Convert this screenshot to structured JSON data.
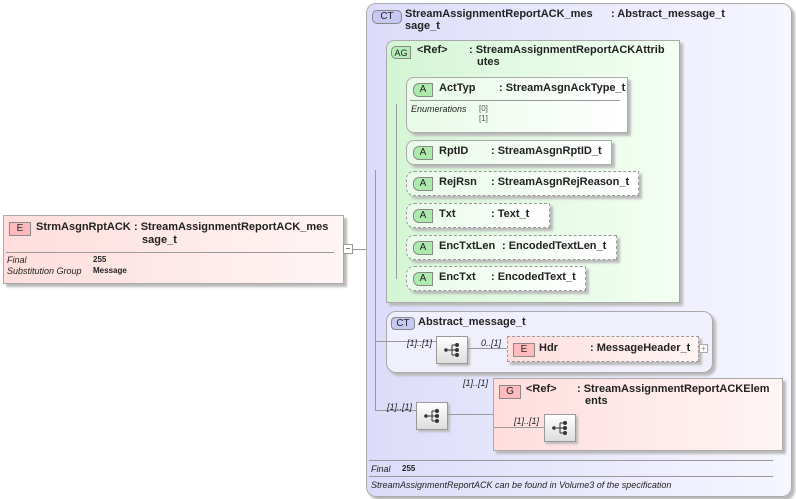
{
  "root": {
    "badge": "E",
    "name": "StrmAsgnRptACK",
    "type_line1": ": StreamAssignmentReportACK_mes",
    "type_line2": "sage_t",
    "props": [
      {
        "label": "Final",
        "value": "255"
      },
      {
        "label": "Substitution Group",
        "value": "Message"
      }
    ]
  },
  "complex_type": {
    "badge": "CT",
    "name": "StreamAssignmentReportACK_mes",
    "type_line1": ": Abstract_message_t",
    "type_line2": "sage_t",
    "line2_prefix": "sage_t",
    "footer_final_label": "Final",
    "footer_final_value": "255",
    "note": "StreamAssignmentReportACK can be found in Volume3 of the specification"
  },
  "attribute_group": {
    "badge": "AG",
    "name": "<Ref>",
    "type_line1": ": StreamAssignmentReportACKAttrib",
    "type_line2": "utes",
    "attributes": [
      {
        "badge": "A",
        "name": "ActTyp",
        "type": ": StreamAsgnAckType_t",
        "enum_label": "Enumerations",
        "enums": [
          "[0]",
          "[1]"
        ]
      },
      {
        "badge": "A",
        "name": "RptID",
        "type": ": StreamAsgnRptID_t"
      },
      {
        "badge": "A",
        "name": "RejRsn",
        "type": ": StreamAsgnRejReason_t"
      },
      {
        "badge": "A",
        "name": "Txt",
        "type": ": Text_t"
      },
      {
        "badge": "A",
        "name": "EncTxtLen",
        "type": ": EncodedTextLen_t"
      },
      {
        "badge": "A",
        "name": "EncTxt",
        "type": ": EncodedText_t"
      }
    ]
  },
  "base_type": {
    "badge": "CT",
    "name": "Abstract_message_t",
    "seq_mult": "[1]..[1]",
    "hdr_mult": "0..[1]",
    "hdr": {
      "badge": "E",
      "name": "Hdr",
      "type": ": MessageHeader_t"
    }
  },
  "group": {
    "badge": "G",
    "name": "<Ref>",
    "type_line1": ": StreamAssignmentReportACKElem",
    "type_line2": "ents",
    "mult": "[1]..[1]",
    "inner_mult": "[1]..[1]",
    "seq_mult": "[1]..[1]"
  }
}
